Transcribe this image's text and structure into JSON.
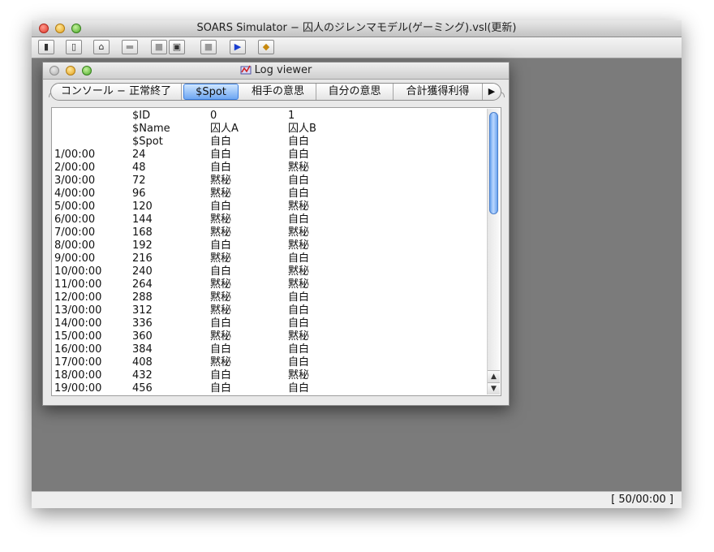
{
  "app": {
    "title": "SOARS Simulator − 囚人のジレンマモデル(ゲーミング).vsl(更新)",
    "status_time": "[ 50/00:00 ]"
  },
  "toolbar": {
    "buttons": [
      {
        "icon": "open-book-icon",
        "glyph": "▮"
      },
      {
        "icon": "new-document-icon",
        "glyph": "▯"
      },
      {
        "icon": "folder-open-icon",
        "glyph": "⌂"
      },
      {
        "icon": "folder-icon-disabled",
        "glyph": "▬"
      },
      {
        "icon": "stop-icon-disabled",
        "glyph": "■"
      },
      {
        "icon": "save-disk-icon",
        "glyph": "▣"
      },
      {
        "icon": "pause-icon-disabled",
        "glyph": "■"
      },
      {
        "icon": "play-icon",
        "glyph": "▶"
      },
      {
        "icon": "package-icon",
        "glyph": "◆"
      }
    ]
  },
  "log_viewer": {
    "title": "Log viewer",
    "tabs": [
      {
        "label": "コンソール − 正常終了",
        "active": false
      },
      {
        "label": "$Spot",
        "active": true
      },
      {
        "label": "相手の意思",
        "active": false
      },
      {
        "label": "自分の意思",
        "active": false
      },
      {
        "label": "合計獲得利得",
        "active": false
      }
    ],
    "tab_more_glyph": "▶",
    "scroll_up_glyph": "▲",
    "scroll_down_glyph": "▼",
    "rows": [
      [
        "",
        "$ID",
        "0",
        "1"
      ],
      [
        "",
        "$Name",
        "囚人A",
        "囚人B"
      ],
      [
        "",
        "$Spot",
        "自白",
        "自白"
      ],
      [
        "1/00:00",
        "24",
        "自白",
        "自白"
      ],
      [
        "2/00:00",
        "48",
        "自白",
        "黙秘"
      ],
      [
        "3/00:00",
        "72",
        "黙秘",
        "自白"
      ],
      [
        "4/00:00",
        "96",
        "黙秘",
        "自白"
      ],
      [
        "5/00:00",
        "120",
        "自白",
        "黙秘"
      ],
      [
        "6/00:00",
        "144",
        "黙秘",
        "自白"
      ],
      [
        "7/00:00",
        "168",
        "黙秘",
        "黙秘"
      ],
      [
        "8/00:00",
        "192",
        "自白",
        "黙秘"
      ],
      [
        "9/00:00",
        "216",
        "黙秘",
        "自白"
      ],
      [
        "10/00:00",
        "240",
        "自白",
        "黙秘"
      ],
      [
        "11/00:00",
        "264",
        "黙秘",
        "黙秘"
      ],
      [
        "12/00:00",
        "288",
        "黙秘",
        "自白"
      ],
      [
        "13/00:00",
        "312",
        "黙秘",
        "自白"
      ],
      [
        "14/00:00",
        "336",
        "自白",
        "自白"
      ],
      [
        "15/00:00",
        "360",
        "黙秘",
        "黙秘"
      ],
      [
        "16/00:00",
        "384",
        "自白",
        "自白"
      ],
      [
        "17/00:00",
        "408",
        "黙秘",
        "自白"
      ],
      [
        "18/00:00",
        "432",
        "自白",
        "黙秘"
      ],
      [
        "19/00:00",
        "456",
        "自白",
        "自白"
      ]
    ]
  }
}
